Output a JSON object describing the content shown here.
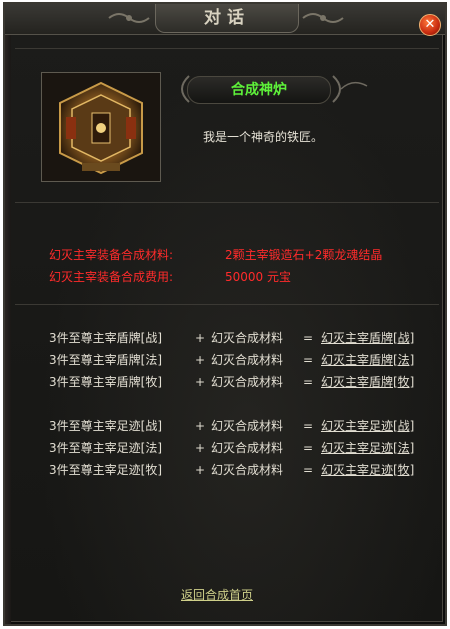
{
  "dialog": {
    "title": "对话",
    "close_icon": "close-icon"
  },
  "npc": {
    "name": "合成神炉",
    "greeting": "我是一个神奇的铁匠。",
    "portrait": "furnace-portrait-icon"
  },
  "requirements": [
    {
      "label": "幻灭主宰装备合成材料:",
      "value": "2颗主宰锻造石+2颗龙魂结晶"
    },
    {
      "label": "幻灭主宰装备合成费用:",
      "value": "50000 元宝"
    }
  ],
  "recipes": [
    {
      "input": "3件至尊主宰盾牌[战]",
      "plus": "+",
      "material": "幻灭合成材料",
      "eq": "=",
      "output": "幻灭主宰盾牌[战]"
    },
    {
      "input": "3件至尊主宰盾牌[法]",
      "plus": "+",
      "material": "幻灭合成材料",
      "eq": "=",
      "output": "幻灭主宰盾牌[法]"
    },
    {
      "input": "3件至尊主宰盾牌[牧]",
      "plus": "+",
      "material": "幻灭合成材料",
      "eq": "=",
      "output": "幻灭主宰盾牌[牧]"
    },
    {
      "input": "3件至尊主宰足迹[战]",
      "plus": "+",
      "material": "幻灭合成材料",
      "eq": "=",
      "output": "幻灭主宰足迹[战]"
    },
    {
      "input": "3件至尊主宰足迹[法]",
      "plus": "+",
      "material": "幻灭合成材料",
      "eq": "=",
      "output": "幻灭主宰足迹[法]"
    },
    {
      "input": "3件至尊主宰足迹[牧]",
      "plus": "+",
      "material": "幻灭合成材料",
      "eq": "=",
      "output": "幻灭主宰足迹[牧]"
    }
  ],
  "back_link": "返回合成首页",
  "colors": {
    "name": "#5ef23a",
    "requirement": "#ff2b2b",
    "text": "#e2ded2",
    "back_link": "#cfd08a",
    "close": "#c82b10"
  }
}
